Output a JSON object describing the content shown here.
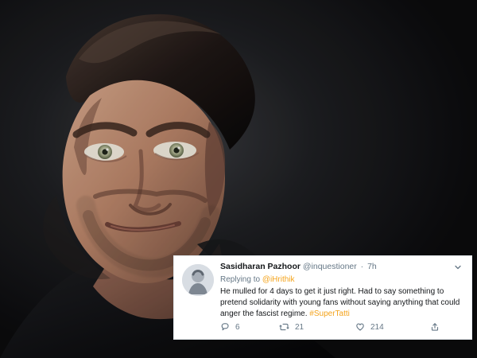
{
  "tweet": {
    "author_name": "Sasidharan Pazhoor",
    "author_handle": "@inquestioner",
    "time_separator": "·",
    "time_ago": "7h",
    "reply_prefix": "Replying to",
    "reply_handle": "@iHrithik",
    "text_lines": [
      "He mulled for 4 days to get it just right. Had to say something to",
      "pretend solidarity with young fans without saying anything that could",
      "anger the fascist regime."
    ],
    "hashtag": "#SuperTatti",
    "actions": {
      "replies": "6",
      "retweets": "21",
      "likes": "214"
    },
    "icons": {
      "avatar": "profile-avatar",
      "menu": "chevron-down-icon",
      "reply": "reply-icon",
      "retweet": "retweet-icon",
      "like": "heart-icon",
      "share": "share-icon"
    }
  },
  "colors": {
    "link": "#f4a31b",
    "muted": "#657786",
    "text": "#14171a",
    "card": "#ffffff"
  }
}
